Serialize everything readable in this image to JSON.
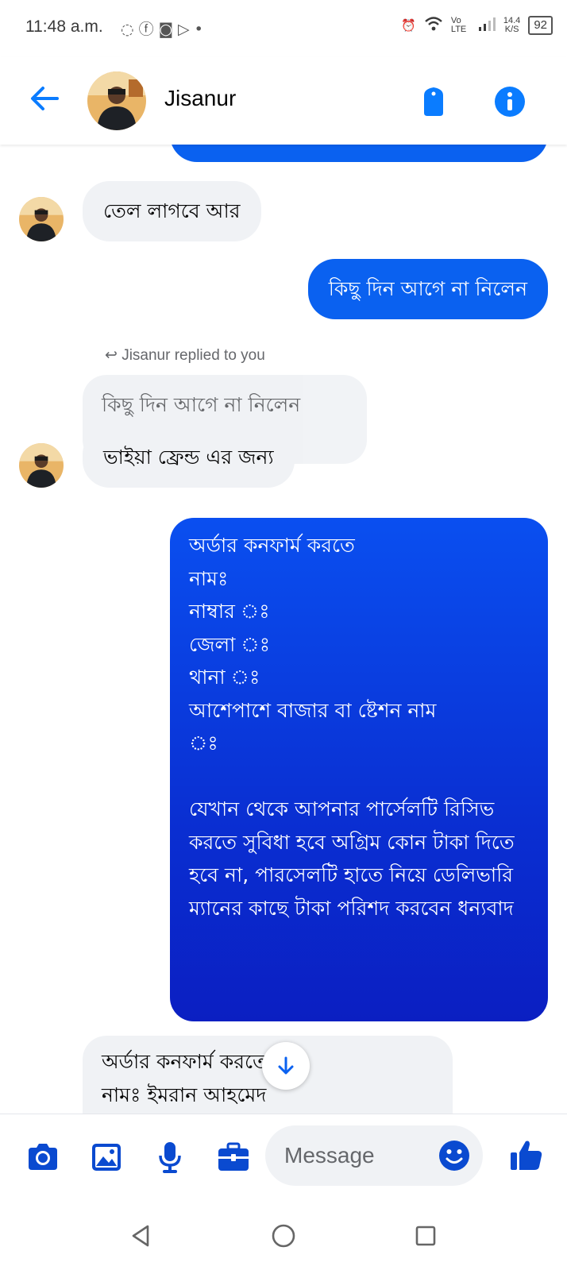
{
  "status_bar": {
    "time": "11:48 a.m.",
    "network_label": "Vo LTE",
    "speed_value": "14.4",
    "speed_unit": "K/S",
    "battery": "92"
  },
  "header": {
    "contact_name": "Jisanur"
  },
  "messages": {
    "m1_in": "তেল লাগবে আর",
    "m2_out": "কিছু দিন আগে না নিলেন",
    "replied_note": "Jisanur replied to you",
    "reply_quote": "কিছু দিন আগে না নিলেন",
    "m3_in": "ভাইয়া ফ্রেন্ড এর জন্য",
    "m4_out": "অর্ডার কনফার্ম করতে\nনামঃ\nনাম্বার ঃ\nজেলা ঃ\nথানা ঃ\nআশেপাশে বাজার বা ষ্টেশন নাম\nঃ\n\nযেখান থেকে আপনার পার্সেলটি রিসিভ করতে সুবিধা হবে অগ্রিম কোন টাকা দিতে হবে না, পারসেলটি হাতে নিয়ে ডেলিভারি ম্যানের কাছে টাকা পরিশদ করবেন ধন্যবাদ",
    "m5_in": "অর্ডার কনফার্ম করতে\nনামঃ ইমরান আহমেদ"
  },
  "composer": {
    "placeholder": "Message"
  },
  "colors": {
    "accent": "#0a7cff",
    "outgoing_bubble": "#0a61f0",
    "incoming_bubble": "#f0f2f5"
  }
}
